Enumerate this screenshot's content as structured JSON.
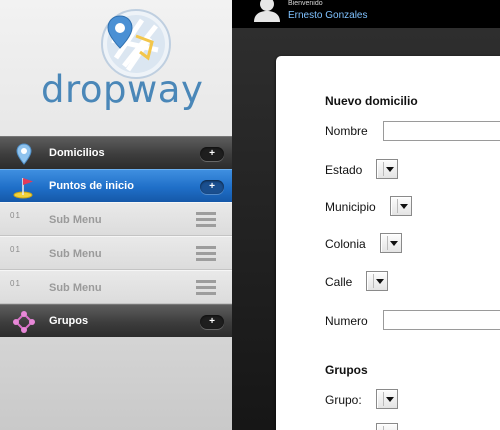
{
  "brand": {
    "name": "dropway"
  },
  "sidebar": {
    "menu": [
      {
        "label": "Domicilios",
        "plus": "+",
        "icon": "location-pin-icon"
      },
      {
        "label": "Puntos de inicio",
        "plus": "+",
        "icon": "flag-icon"
      },
      {
        "label": "Grupos",
        "plus": "+",
        "icon": "group-network-icon"
      }
    ],
    "sub_items": [
      {
        "num": "01",
        "label": "Sub Menu"
      },
      {
        "num": "01",
        "label": "Sub Menu"
      },
      {
        "num": "01",
        "label": "Sub Menu"
      }
    ]
  },
  "header": {
    "greeting": "Bienvenido",
    "user_name": "Ernesto Gonzales"
  },
  "form": {
    "title": "Nuevo domicilio",
    "fields": {
      "nombre": "Nombre",
      "estado": "Estado",
      "municipio": "Municipio",
      "colonia": "Colonia",
      "calle": "Calle",
      "numero": "Numero"
    },
    "groups_title": "Grupos",
    "grupo_label": "Grupo:"
  },
  "colors": {
    "accent": "#1f6fc8",
    "brand": "#4a87b8",
    "link": "#7fc2ff"
  }
}
